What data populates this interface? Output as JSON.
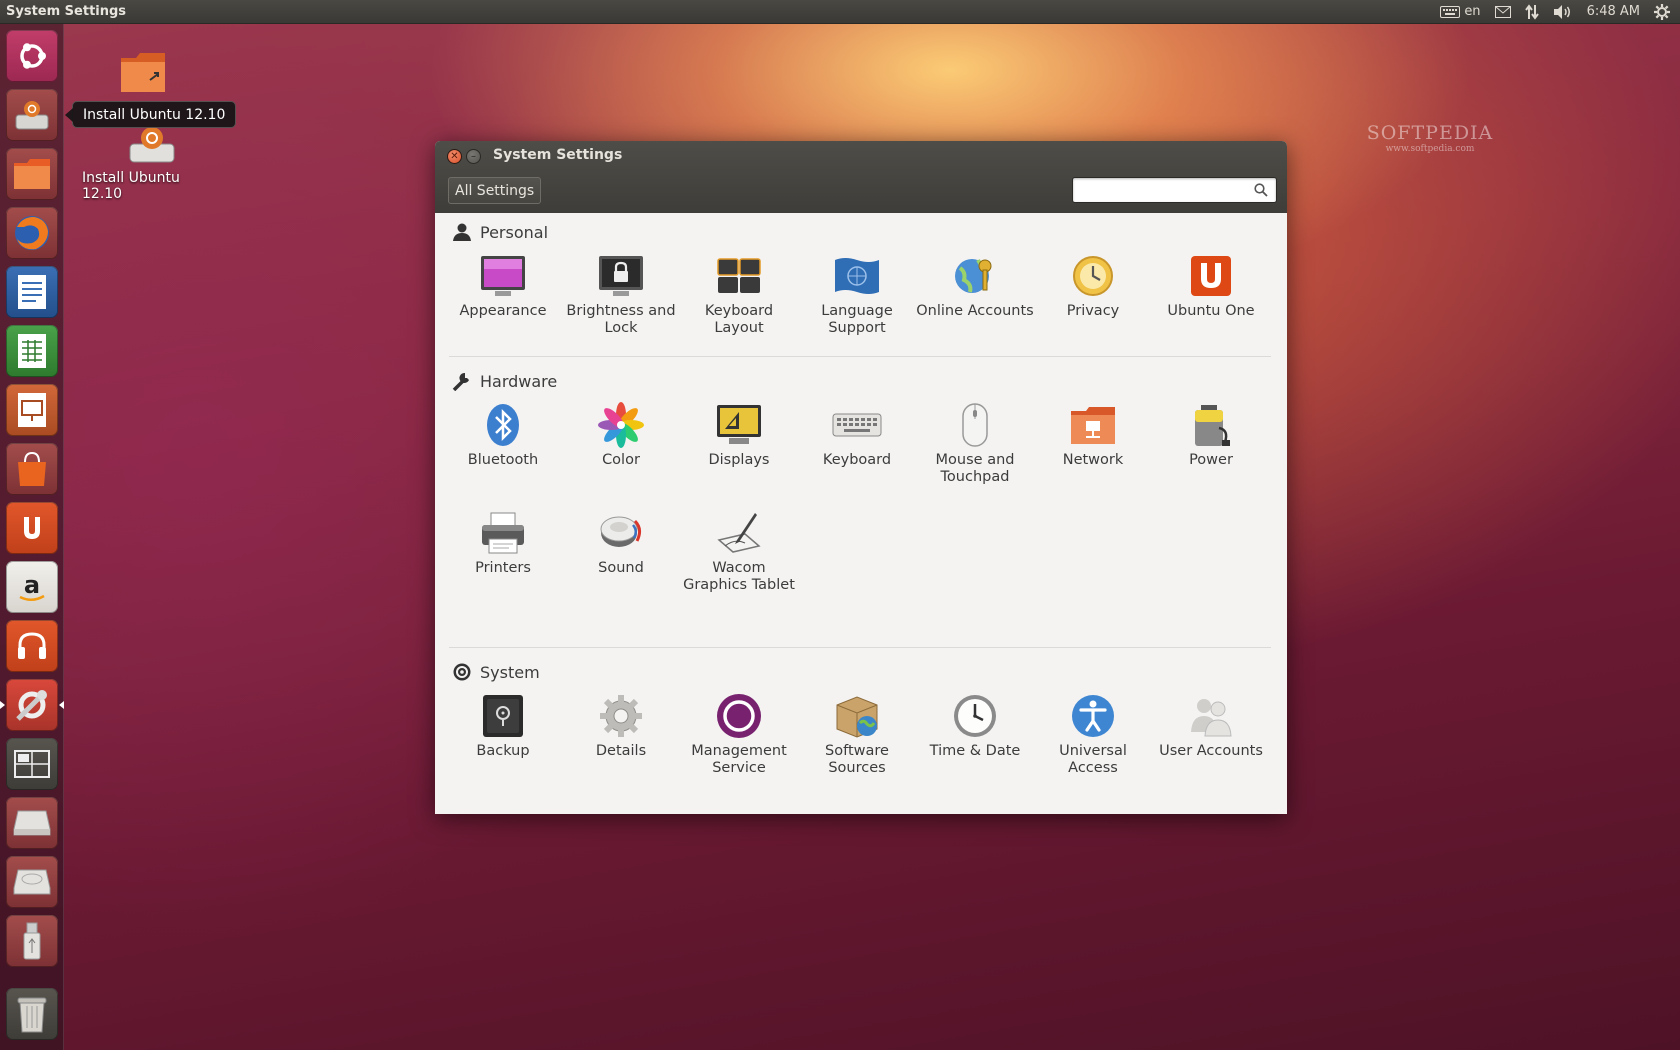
{
  "top_panel": {
    "title": "System Settings",
    "keyboard_layout": "en",
    "clock": "6:48 AM",
    "indicators": [
      "keyboard-icon",
      "mail-icon",
      "network-icon",
      "volume-icon",
      "session-gear-icon"
    ]
  },
  "launcher": {
    "items": [
      "dash-home",
      "install-ubuntu",
      "files",
      "firefox",
      "libreoffice-writer",
      "libreoffice-calc",
      "libreoffice-impress",
      "ubuntu-software-center",
      "ubuntu-one",
      "amazon",
      "ubuntu-one-music",
      "system-settings",
      "workspace-switcher",
      "drive",
      "drive-2",
      "usb-drive",
      "trash"
    ],
    "tooltip": "Install Ubuntu 12.10"
  },
  "desktop": {
    "icons": [
      {
        "label": "Install Ubuntu 12.10"
      }
    ]
  },
  "watermark": {
    "brand": "SOFTPEDIA",
    "url": "www.softpedia.com"
  },
  "window": {
    "title": "System Settings",
    "all_settings_label": "All Settings",
    "search_placeholder": "",
    "sections": [
      {
        "name": "Personal",
        "items": [
          "Appearance",
          "Brightness and Lock",
          "Keyboard Layout",
          "Language Support",
          "Online Accounts",
          "Privacy",
          "Ubuntu One"
        ]
      },
      {
        "name": "Hardware",
        "items": [
          "Bluetooth",
          "Color",
          "Displays",
          "Keyboard",
          "Mouse and Touchpad",
          "Network",
          "Power",
          "Printers",
          "Sound",
          "Wacom Graphics Tablet"
        ]
      },
      {
        "name": "System",
        "items": [
          "Backup",
          "Details",
          "Management Service",
          "Software Sources",
          "Time & Date",
          "Universal Access",
          "User Accounts"
        ]
      }
    ]
  },
  "colors": {
    "accent": "#dd4814",
    "panel": "#3c3b37",
    "window_bg": "#f2f1f0"
  }
}
